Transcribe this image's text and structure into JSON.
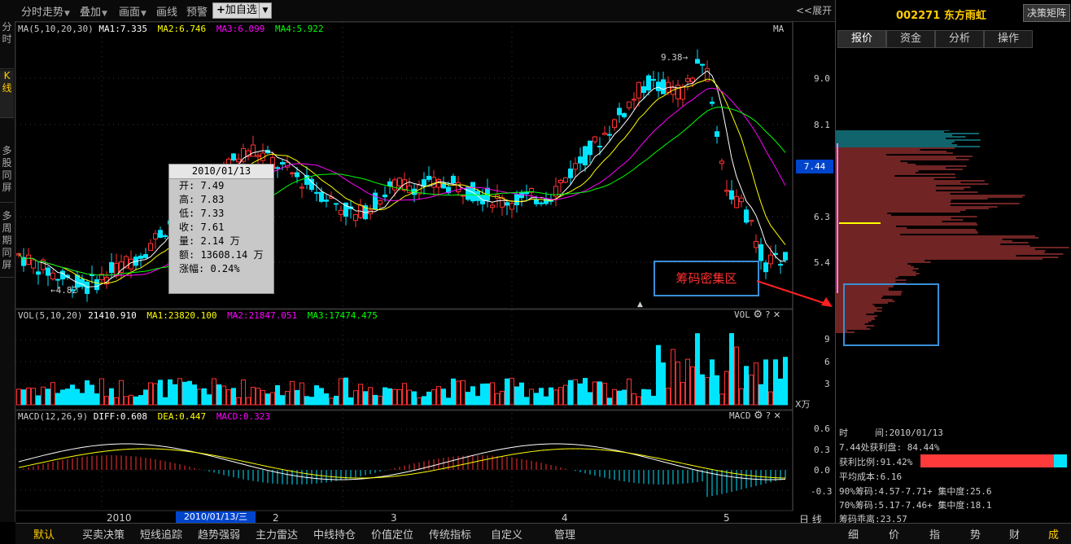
{
  "toolbar": {
    "items": [
      "分时走势",
      "叠加",
      "画面",
      "画线",
      "预警"
    ],
    "add_watchlist": "加自选",
    "expand": "<<展开"
  },
  "left_tabs": [
    "分时",
    "K线",
    "多股同屏",
    "多周期同屏"
  ],
  "stock": {
    "code": "002271",
    "name": "东方雨虹",
    "matrix_btn": "决策矩阵"
  },
  "right_tabs": [
    "报价",
    "资金",
    "分析",
    "操作"
  ],
  "main_panel": {
    "ma_header": {
      "label": "MA(5,10,20,30)",
      "ma1": "MA1:7.335",
      "ma2": "MA2:6.746",
      "ma3": "MA3:6.099",
      "ma4": "MA4:5.922"
    },
    "corner": "MA",
    "price_high_label": "9.38",
    "price_low_label": "4.82",
    "axis": [
      "9.0",
      "8.1",
      "6.3",
      "5.4"
    ],
    "current_price": "7.44"
  },
  "vol_panel": {
    "header": {
      "label": "VOL(5,10,20)",
      "value": "21410.910",
      "ma1": "MA1:23820.100",
      "ma2": "MA2:21847.051",
      "ma3": "MA3:17474.475"
    },
    "corner": "VOL",
    "axis": [
      "9",
      "6",
      "3"
    ],
    "unit": "X万"
  },
  "macd_panel": {
    "header": {
      "label": "MACD(12,26,9)",
      "diff": "DIFF:0.608",
      "dea": "DEA:0.447",
      "macd": "MACD:0.323"
    },
    "corner": "MACD",
    "axis": [
      "0.6",
      "0.3",
      "0.0",
      "-0.3"
    ]
  },
  "x_axis": {
    "labels": [
      "2010",
      "2",
      "3",
      "4",
      "5"
    ],
    "cursor_date": "2010/01/13/三",
    "period": "日 线"
  },
  "tooltip": {
    "date": "2010/01/13",
    "rows": [
      "开: 7.49",
      "高: 7.83",
      "低: 7.33",
      "收: 7.61",
      "量: 2.14 万",
      "额: 13608.14 万",
      "涨幅: 0.24%"
    ]
  },
  "annotation": "筹码密集区",
  "chip_info": {
    "time": "时　　　间:2010/01/13",
    "profit_at": "7.44处获利盘: 84.44%",
    "profit_ratio": "获利比例:91.42%",
    "avg_cost": "平均成本:6.16",
    "chip90": "90%筹码:4.57-7.71+ 集中度:25.6",
    "chip70": "70%筹码:5.17-7.46+ 集中度:18.1",
    "chip_dist": "筹码乖离:23.57",
    "profit_ratio_value": 0.9142
  },
  "bottom_tabs": [
    "默认",
    "买卖决策",
    "短线追踪",
    "趋势强弱",
    "主力雷达",
    "中线持仓",
    "价值定位",
    "传统指标",
    "自定义",
    "管理"
  ],
  "right_bottom_tabs": [
    "细",
    "价",
    "指",
    "势",
    "财",
    "成"
  ],
  "colors": {
    "up": "#ff3232",
    "down": "#00e5ff",
    "ma1": "#ffffff",
    "ma2": "#ffff00",
    "ma3": "#ff00ff",
    "ma4": "#00ff00"
  }
}
